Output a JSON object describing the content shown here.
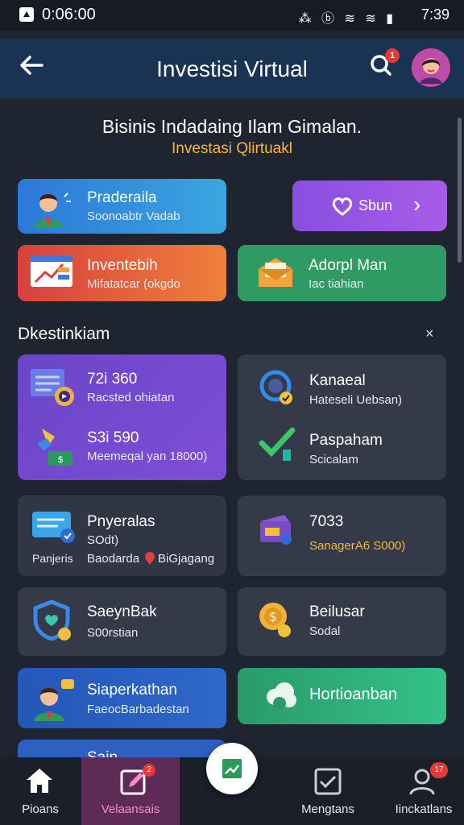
{
  "status_bar": {
    "time": "0:06:00",
    "clock_right": "7:39",
    "icons": "⁂ ⓑ ≋ ≋ ▮"
  },
  "app_bar": {
    "title": "Investisi Virtual",
    "notification_count": "1",
    "back_icon": "arrow-left-icon",
    "search_icon": "search-icon"
  },
  "hero": {
    "title": "Bisinis Indadaing Ilam Gimalan.",
    "subtitle": "Investasi Qlirtuakl"
  },
  "quick_cards": {
    "pro": {
      "title": "Praderaila",
      "subtitle": "Soonoabtr Vadab"
    },
    "open": {
      "label": "Sbun",
      "arrow": "›"
    },
    "invest": {
      "title": "Inventebih",
      "subtitle": "Mifatatcar (okgdo"
    },
    "adopt": {
      "title": "Adorpl Man",
      "subtitle": "Iac tiahian"
    }
  },
  "section": {
    "title": "Dkestinkiam",
    "close": "×"
  },
  "grid": {
    "purple": {
      "row1": {
        "title": "72i 360",
        "subtitle": "Racsted ohiatan"
      },
      "row2": {
        "title": "S3i 590",
        "subtitle": "Meemeqal yan 18000)"
      }
    },
    "dark1": {
      "row1": {
        "title": "Kanaeal",
        "subtitle": "Hateseli Uebsan)"
      },
      "row2": {
        "title": "Paspaham",
        "subtitle": "Scicalam"
      }
    },
    "dark2": {
      "title": "Pnyeralas",
      "line2": "SOdt)",
      "caption": "Panjeris",
      "subtitle": "Baodarda",
      "subtitle2": "BiGjagang"
    },
    "dark3": {
      "title": "7033",
      "subtitle": "SanagerA6 S000)"
    },
    "dark4": {
      "title": "SaeynBak",
      "subtitle": "S00rstian"
    },
    "dark5": {
      "title": "Beilusar",
      "subtitle": "Sodal"
    },
    "blue": {
      "title": "Siaperkathan",
      "subtitle": "FaeocBarbadestan"
    },
    "green": {
      "title": "Hortioanban"
    },
    "peek": {
      "title": "Sain"
    }
  },
  "bottom_nav": [
    {
      "label": "Pioans",
      "icon": "home-icon"
    },
    {
      "label": "Velaansais",
      "icon": "edit-icon",
      "badge": "2"
    },
    {
      "label": "",
      "icon": "chart-icon"
    },
    {
      "label": "Mengtans",
      "icon": "check-square-icon"
    },
    {
      "label": "Iinckatlans",
      "icon": "user-icon",
      "badge": "17"
    }
  ],
  "colors": {
    "accent_yellow": "#f6b73c",
    "appbar": "#1b3352",
    "badge_red": "#e53935"
  }
}
